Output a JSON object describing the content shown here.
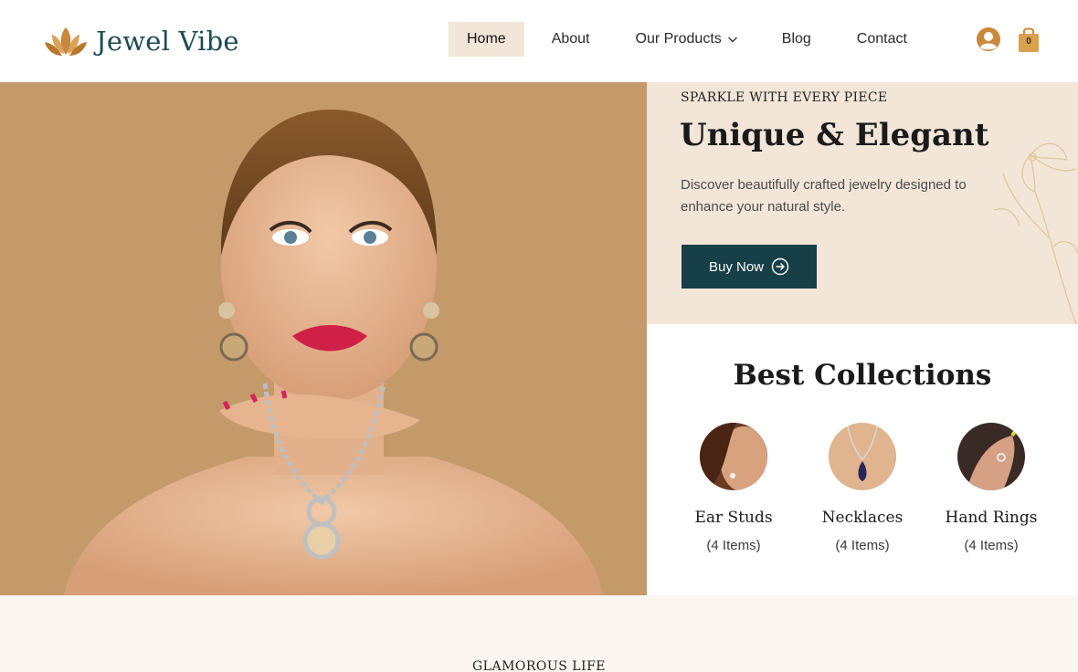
{
  "brand": {
    "name": "Jewel Vibe",
    "logo_icon": "lotus-icon",
    "accent": "#c9883c",
    "primary": "#163f48"
  },
  "nav": {
    "items": [
      {
        "label": "Home",
        "active": true
      },
      {
        "label": "About"
      },
      {
        "label": "Our Products",
        "icon": "chevron-down-icon"
      },
      {
        "label": "Blog"
      },
      {
        "label": "Contact"
      }
    ]
  },
  "header_actions": {
    "user_icon": "user-icon",
    "cart_icon": "shopping-bag-icon",
    "cart_count": "0"
  },
  "hero": {
    "eyebrow": "SPARKLE WITH EVERY PIECE",
    "title": "Unique & Elegant",
    "description": "Discover beautifully crafted jewelry designed to enhance your natural style.",
    "cta_label": "Buy Now",
    "cta_icon": "arrow-right-circle-icon"
  },
  "collections": {
    "title": "Best Collections",
    "items": [
      {
        "name": "Ear Studs",
        "count": "(4 Items)"
      },
      {
        "name": "Necklaces",
        "count": "(4 Items)"
      },
      {
        "name": "Hand Rings",
        "count": "(4 Items)"
      }
    ]
  },
  "section2": {
    "eyebrow": "GLAMOROUS LIFE"
  }
}
